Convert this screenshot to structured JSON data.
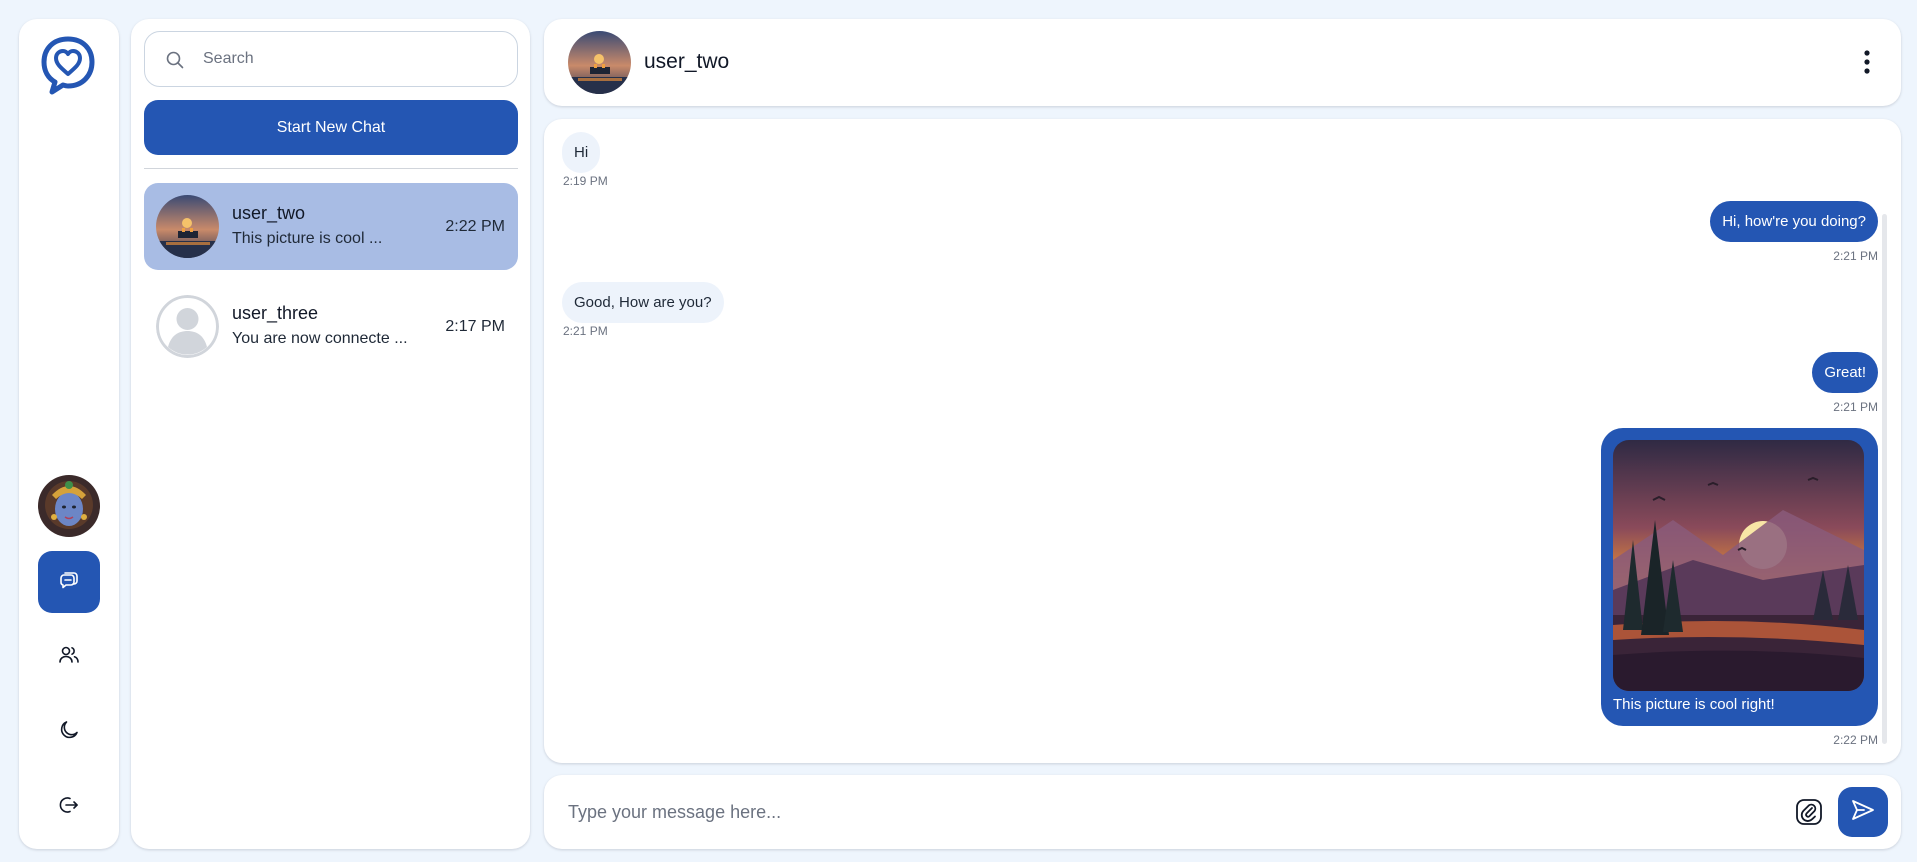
{
  "colors": {
    "accent": "#2456b3",
    "selected_chat": "#a8bce4",
    "incoming_bubble": "#edf3fb",
    "background": "#eef5fd"
  },
  "sidebar": {
    "logo_icon": "chat-heart-logo",
    "profile_avatar": "user-avatar-image",
    "nav": [
      {
        "icon": "chats-icon",
        "active": true
      },
      {
        "icon": "contacts-icon",
        "active": false
      },
      {
        "icon": "moon-icon",
        "active": false
      },
      {
        "icon": "logout-icon",
        "active": false
      }
    ]
  },
  "chat_list": {
    "search_placeholder": "Search",
    "new_chat_label": "Start New Chat",
    "items": [
      {
        "name": "user_two",
        "preview": "This picture is cool ...",
        "time": "2:22 PM",
        "selected": true
      },
      {
        "name": "user_three",
        "preview": "You are now connecte ...",
        "time": "2:17 PM",
        "selected": false
      }
    ]
  },
  "conversation": {
    "name": "user_two",
    "messages": [
      {
        "direction": "in",
        "text": "Hi",
        "time": "2:19 PM"
      },
      {
        "direction": "out",
        "text": "Hi, how're you doing?",
        "time": "2:21 PM"
      },
      {
        "direction": "in",
        "text": "Good, How are you?",
        "time": "2:21 PM"
      },
      {
        "direction": "out",
        "text": "Great!",
        "time": "2:21 PM"
      },
      {
        "direction": "out",
        "image": "sunset-landscape-image",
        "text": "This picture is cool right!",
        "time": "2:22 PM"
      }
    ]
  },
  "composer": {
    "placeholder": "Type your message here..."
  }
}
